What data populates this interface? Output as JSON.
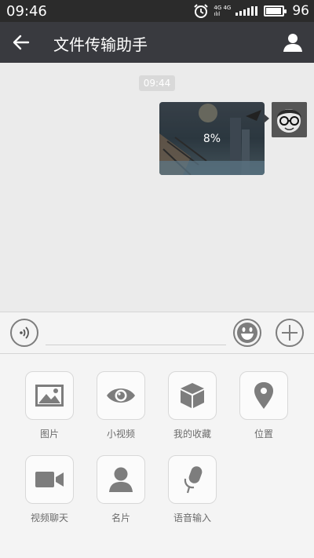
{
  "status_bar": {
    "time": "09:46",
    "network_label_top": "4G 4G",
    "network_label_bottom": "ılıl",
    "battery_level": "96",
    "battery_fraction": 0.96
  },
  "header": {
    "title": "文件传输助手"
  },
  "chat": {
    "timestamp": "09:44",
    "image_message": {
      "upload_progress": "8%"
    }
  },
  "input_bar": {
    "input_value": "",
    "placeholder": ""
  },
  "panel": {
    "items": [
      {
        "label": "图片",
        "icon": "image-icon"
      },
      {
        "label": "小视频",
        "icon": "eye-icon"
      },
      {
        "label": "我的收藏",
        "icon": "box-icon"
      },
      {
        "label": "位置",
        "icon": "location-pin-icon"
      },
      {
        "label": "视频聊天",
        "icon": "video-camera-icon"
      },
      {
        "label": "名片",
        "icon": "person-icon"
      },
      {
        "label": "语音输入",
        "icon": "microphone-icon"
      }
    ]
  },
  "colors": {
    "status_bar": "#2b2b2b",
    "title_bar": "#393a3f",
    "chat_background": "#ebebeb",
    "panel_background": "#f4f4f4",
    "icon_gray": "#7d7d7d"
  }
}
